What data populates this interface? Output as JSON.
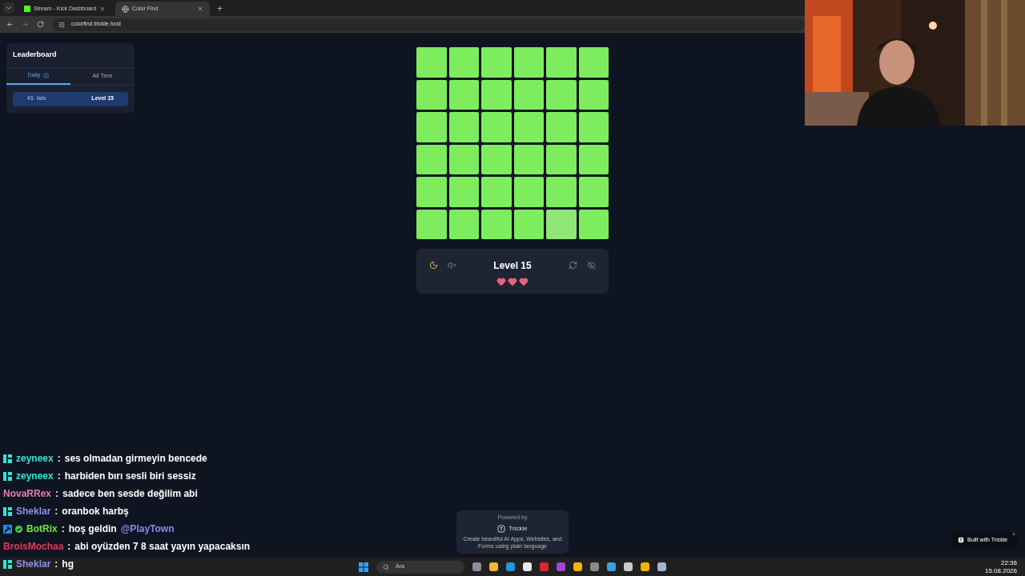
{
  "browser": {
    "tabs": [
      {
        "title": "Stream - Kick Dashboard",
        "selected": false
      },
      {
        "title": "Color Find",
        "selected": true
      }
    ],
    "url": "colorfind.trickle.host"
  },
  "leaderboard": {
    "title": "Leaderboard",
    "tabs": [
      {
        "label": "Daily",
        "selected": true
      },
      {
        "label": "All Time",
        "selected": false
      }
    ],
    "entries": [
      {
        "rank": "#1",
        "name": "late",
        "score": "Level 15"
      }
    ]
  },
  "grid": {
    "rows": [
      [
        {
          "color": "#7ded5e"
        },
        {
          "color": "#7ded5e"
        },
        {
          "color": "#7ded5e"
        },
        {
          "color": "#7ded5e"
        },
        {
          "color": "#7ded5e"
        },
        {
          "color": "#7ded5e"
        }
      ],
      [
        {
          "color": "#7ded5e"
        },
        {
          "color": "#7ded5e"
        },
        {
          "color": "#7ded5e"
        },
        {
          "color": "#7ded5e"
        },
        {
          "color": "#7ded5e"
        },
        {
          "color": "#7ded5e"
        }
      ],
      [
        {
          "color": "#7ded5e"
        },
        {
          "color": "#7ded5e"
        },
        {
          "color": "#7ded5e"
        },
        {
          "color": "#7ded5e"
        },
        {
          "color": "#7ded5e"
        },
        {
          "color": "#7ded5e"
        }
      ],
      [
        {
          "color": "#7ded5e"
        },
        {
          "color": "#7ded5e"
        },
        {
          "color": "#7ded5e"
        },
        {
          "color": "#7ded5e"
        },
        {
          "color": "#7ded5e"
        },
        {
          "color": "#7ded5e"
        }
      ],
      [
        {
          "color": "#7ded5e"
        },
        {
          "color": "#7ded5e"
        },
        {
          "color": "#7ded5e"
        },
        {
          "color": "#7ded5e"
        },
        {
          "color": "#7ded5e"
        },
        {
          "color": "#7ded5e"
        }
      ],
      [
        {
          "color": "#7ded5e"
        },
        {
          "color": "#7ded5e"
        },
        {
          "color": "#7ded5e"
        },
        {
          "color": "#7ded5e"
        },
        {
          "color": "#8ee676"
        },
        {
          "color": "#7ded5e"
        }
      ]
    ]
  },
  "status": {
    "level": "Level 15",
    "muted": true,
    "hearts": [
      {
        "filled": true
      },
      {
        "filled": true
      },
      {
        "filled": true
      }
    ]
  },
  "powered": {
    "caption": "Powered by",
    "brand": "Trickle",
    "tagline": "Create beautiful AI Apps, Websites, and Forms using plain language"
  },
  "built_badge": {
    "label": "Built with Trickle",
    "close": "×"
  },
  "chat": [
    {
      "kind": "subscriber",
      "user": "zeyneex",
      "color": "#2ee6d6",
      "separator": ":",
      "message": "ses olmadan girmeyin bencede"
    },
    {
      "kind": "subscriber",
      "user": "zeyneex",
      "color": "#2ee6d6",
      "separator": ":",
      "message": "harbiden bırı sesli biri sessiz"
    },
    {
      "kind": "plain",
      "user": "NovaRRex",
      "color": "#f07aa8",
      "separator": ":",
      "message": "sadece ben sesde değilim abi"
    },
    {
      "kind": "subscriber",
      "user": "Sheklar",
      "color": "#8f8ff0",
      "separator": ":",
      "message": "oranbok harbş"
    },
    {
      "kind": "bot",
      "user": "BotRix",
      "color": "#6ee83a",
      "separator": ":",
      "message": "hoş geldin",
      "mention": "@PlayTown"
    },
    {
      "kind": "plain",
      "user": "BroisMochaa",
      "color": "#e8365e",
      "separator": ":",
      "message": "abi oyüzden 7 8 saat yayın yapacaksın"
    },
    {
      "kind": "subscriber",
      "user": "Sheklar",
      "color": "#8f8ff0",
      "separator": ":",
      "message": "hg"
    }
  ],
  "taskbar": {
    "search": "Ara",
    "time": "22:36",
    "date": "15.08.2026"
  }
}
